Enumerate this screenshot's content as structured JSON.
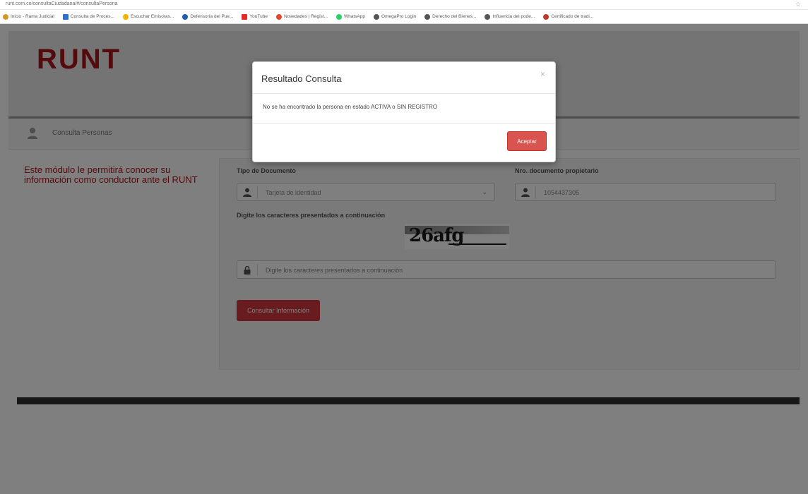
{
  "browser": {
    "url": "runt.com.co/consultaCiudadana/#/consultaPersona",
    "bookmarks": [
      {
        "label": "Inicio - Rama Judicial",
        "icon": "globe-icon",
        "color": "#d19a2a"
      },
      {
        "label": "Consulta de Proces...",
        "icon": "document-icon",
        "color": "#2e6fcf"
      },
      {
        "label": "Escuchar Emisoras...",
        "icon": "radio-icon",
        "color": "#f0b400"
      },
      {
        "label": "Defensoría del Pue...",
        "icon": "shield-icon",
        "color": "#1f5fa8"
      },
      {
        "label": "YouTube",
        "icon": "youtube-icon",
        "color": "#e52d27"
      },
      {
        "label": "Novedades | Regist...",
        "icon": "arrow-icon",
        "color": "#e2482c"
      },
      {
        "label": "WhatsApp",
        "icon": "whatsapp-icon",
        "color": "#25d366"
      },
      {
        "label": "OmegaPro Login",
        "icon": "globe-icon",
        "color": "#555555"
      },
      {
        "label": "Derecho del Bienes...",
        "icon": "globe-icon",
        "color": "#555555"
      },
      {
        "label": "Influencia del pode...",
        "icon": "globe-icon",
        "color": "#555555"
      },
      {
        "label": "Certificado de tradi...",
        "icon": "car-icon",
        "color": "#c0392b"
      }
    ]
  },
  "header": {
    "logo": "RUNT"
  },
  "breadcrumb": {
    "label": "Consulta Personas"
  },
  "intro": {
    "text": "Este módulo le permitirá conocer su información como conductor ante el RUNT"
  },
  "form": {
    "doc_type_label": "Tipo de Documento",
    "doc_type_value": "Tarjeta de identidad",
    "doc_number_label": "Nro. documento propietario",
    "doc_number_value": "1054437305",
    "captcha_label": "Digite los caracteres presentados a continuación",
    "captcha_text": "26afg",
    "captcha_placeholder": "Digite los caracteres presentados a continuación",
    "submit_label": "Consultar Información"
  },
  "modal": {
    "title": "Resultado Consulta",
    "close": "×",
    "message": "No se ha encontrado la persona en estado ACTIVA o SIN REGISTRO",
    "accept_label": "Aceptar"
  },
  "colors": {
    "brand": "#a6171c",
    "button": "#d9534f"
  }
}
